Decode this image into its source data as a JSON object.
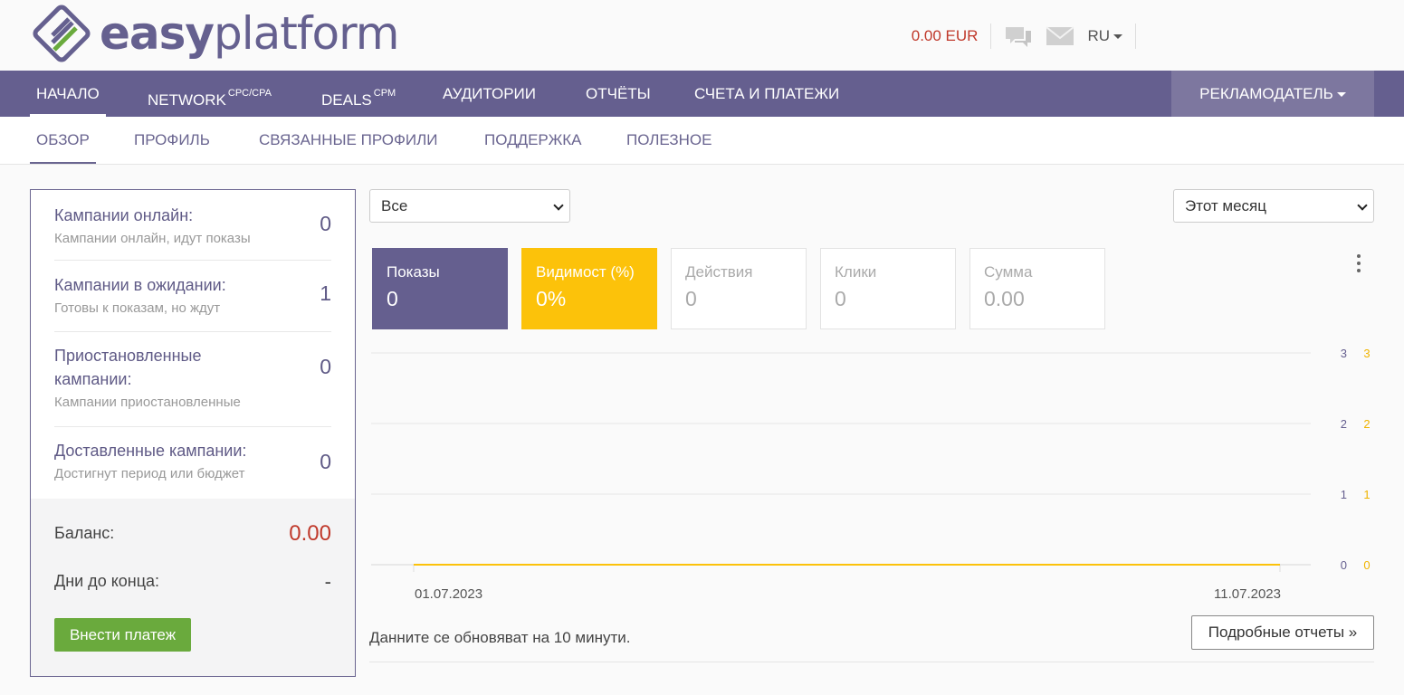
{
  "brand": {
    "name_bold": "easy",
    "name_light": "platform"
  },
  "header": {
    "balance": "0.00 EUR",
    "language": "RU"
  },
  "main_nav": {
    "items": [
      {
        "label": "НАЧАЛО",
        "sup": ""
      },
      {
        "label": "NETWORK",
        "sup": "CPC/CPA"
      },
      {
        "label": "DEALS",
        "sup": "CPM"
      },
      {
        "label": "АУДИТОРИИ",
        "sup": ""
      },
      {
        "label": "ОТЧЁТЫ",
        "sup": ""
      },
      {
        "label": "СЧЕТА И ПЛАТЕЖИ",
        "sup": ""
      }
    ],
    "role": "РЕКЛАМОДАТЕЛЬ"
  },
  "sub_nav": {
    "items": [
      "ОБЗОР",
      "ПРОФИЛЬ",
      "СВЯЗАННЫЕ ПРОФИЛИ",
      "ПОДДЕРЖКА",
      "ПОЛЕЗНОЕ"
    ]
  },
  "campaigns": [
    {
      "title": "Кампании онлайн:",
      "subtitle": "Кампании онлайн, идут показы",
      "value": "0"
    },
    {
      "title": "Кампании в ожидании:",
      "subtitle": "Готовы к показам, но ждут",
      "value": "1"
    },
    {
      "title": "Приостановленные кампании:",
      "subtitle": "Кампании приостановленные",
      "value": "0"
    },
    {
      "title": "Доставленные кампании:",
      "subtitle": "Достигнут период или бюджет",
      "value": "0"
    }
  ],
  "summary": {
    "balance_label": "Баланс:",
    "balance_value": "0.00",
    "days_label": "Дни до конца:",
    "days_value": "-",
    "pay_button": "Внести платеж"
  },
  "filters": {
    "campaign_select": "Все",
    "period_select": "Этот месяц"
  },
  "metrics": [
    {
      "label": "Показы",
      "value": "0"
    },
    {
      "label": "Видимост (%)",
      "value": "0%"
    },
    {
      "label": "Действия",
      "value": "0"
    },
    {
      "label": "Клики",
      "value": "0"
    },
    {
      "label": "Сумма",
      "value": "0.00"
    }
  ],
  "colors": {
    "purple": "#655f8f",
    "yellow": "#fcc20a",
    "green": "#6aaa3d",
    "red": "#c0392b"
  },
  "chart_data": {
    "type": "line",
    "x": [
      "01.07.2023",
      "11.07.2023"
    ],
    "x_tick_labels": [
      "01.07.2023",
      "11.07.2023"
    ],
    "series": [
      {
        "values": [
          0,
          0
        ],
        "axis": "left",
        "color": "#655f8f"
      },
      {
        "values": [
          0,
          0
        ],
        "axis": "right",
        "color": "#fcc20a"
      }
    ],
    "ylim_left": [
      0,
      3
    ],
    "ylim_right": [
      0,
      3
    ],
    "y_ticks_left": [
      0,
      1,
      2,
      3
    ],
    "y_ticks_right": [
      0,
      1,
      2,
      3
    ],
    "grid": true
  },
  "footer": {
    "note": "Данните се обновяват на 10 минути.",
    "report_button": "Подробные отчеты »"
  }
}
